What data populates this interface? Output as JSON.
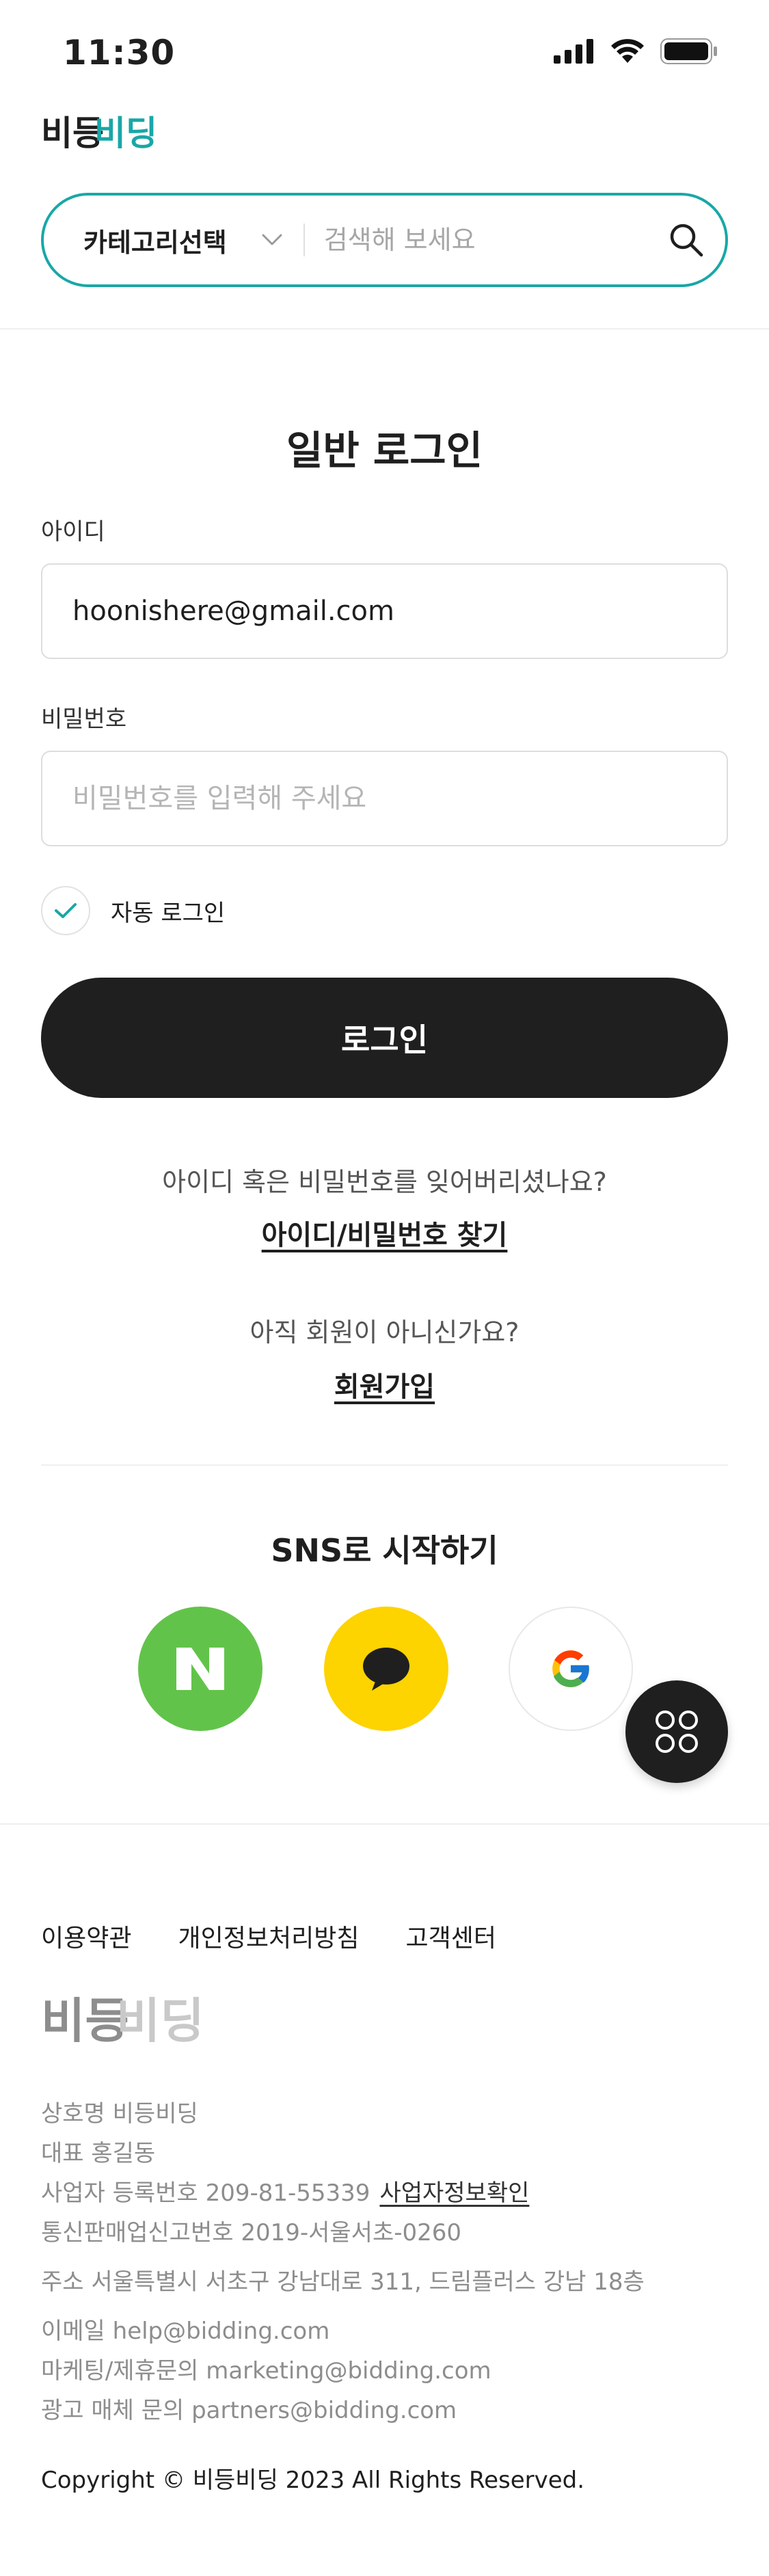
{
  "status_bar": {
    "time": "11:30"
  },
  "header": {
    "logo_text": {
      "part1": "비등",
      "part2": "비딩"
    },
    "search": {
      "category_label": "카테고리선택",
      "placeholder": "검색해 보세요"
    }
  },
  "login": {
    "title": "일반 로그인",
    "id_label": "아이디",
    "id_value": "hoonishere@gmail.com",
    "password_label": "비밀번호",
    "password_placeholder": "비밀번호를 입력해 주세요",
    "auto_login_label": "자동 로그인",
    "auto_login_checked": true,
    "login_button": "로그인",
    "forgot_text": "아이디 혹은 비밀번호를 잊어버리셨나요?",
    "forgot_link": "아이디/비밀번호 찾기",
    "not_member_text": "아직 회원이 아니신가요?",
    "signup_link": "회원가입"
  },
  "sns": {
    "title": "SNS로 시작하기",
    "providers": [
      {
        "name": "naver",
        "icon": "naver-icon",
        "color": "#62c34a"
      },
      {
        "name": "kakao",
        "icon": "kakao-icon",
        "color": "#fdd300"
      },
      {
        "name": "google",
        "icon": "google-icon",
        "color": "#ffffff"
      }
    ]
  },
  "footer": {
    "links": [
      "이용약관",
      "개인정보처리방침",
      "고객센터"
    ],
    "logo_text": {
      "part1": "비등",
      "part2": "비딩"
    },
    "company_name": "상호명 비등비딩",
    "ceo": "대표 홍길동",
    "business_number": "사업자 등록번호 209-81-55339",
    "business_info_link": "사업자정보확인",
    "mail_order_number": "통신판매업신고번호 2019-서울서초-0260",
    "address": "주소 서울특별시 서초구 강남대로 311, 드림플러스 강남 18층",
    "email": "이메일 help@bidding.com",
    "marketing_email": "마케팅/제휴문의 marketing@bidding.com",
    "ads_email": "광고 매체 문의 partners@bidding.com",
    "copyright": "Copyright © 비등비딩 2023 All Rights Reserved."
  },
  "colors": {
    "accent": "#19a7a7",
    "dark": "#1f1f1f",
    "naver": "#62c34a",
    "kakao": "#fdd300"
  }
}
